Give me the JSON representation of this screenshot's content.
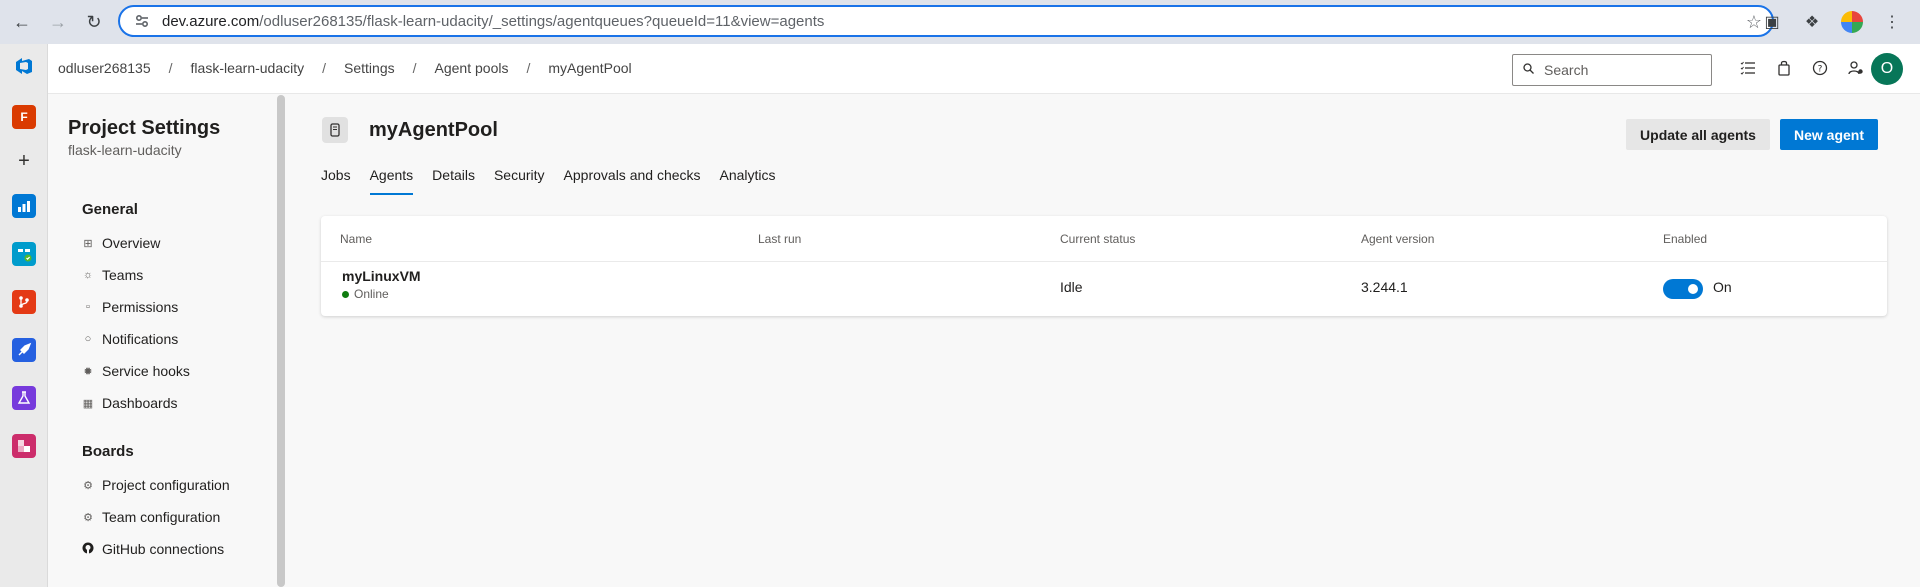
{
  "browser": {
    "url_host": "dev.azure.com",
    "url_path": "/odluser268135/flask-learn-udacity/_settings/agentqueues?queueId=11&view=agents"
  },
  "breadcrumb": {
    "items": [
      "odluser268135",
      "flask-learn-udacity",
      "Settings",
      "Agent pools",
      "myAgentPool"
    ],
    "separator": "/"
  },
  "search": {
    "placeholder": "Search"
  },
  "user": {
    "avatar_initial": "O"
  },
  "rail": {
    "project_initial": "F"
  },
  "settings_nav": {
    "title": "Project Settings",
    "subtitle": "flask-learn-udacity",
    "groups": [
      {
        "label": "General",
        "items": [
          "Overview",
          "Teams",
          "Permissions",
          "Notifications",
          "Service hooks",
          "Dashboards"
        ]
      },
      {
        "label": "Boards",
        "items": [
          "Project configuration",
          "Team configuration",
          "GitHub connections"
        ]
      }
    ]
  },
  "pool": {
    "title": "myAgentPool",
    "update_button": "Update all agents",
    "new_button": "New agent"
  },
  "tabs": [
    {
      "label": "Jobs",
      "active": false
    },
    {
      "label": "Agents",
      "active": true
    },
    {
      "label": "Details",
      "active": false
    },
    {
      "label": "Security",
      "active": false
    },
    {
      "label": "Approvals and checks",
      "active": false
    },
    {
      "label": "Analytics",
      "active": false
    }
  ],
  "table": {
    "columns": [
      "Name",
      "Last run",
      "Current status",
      "Agent version",
      "Enabled"
    ],
    "rows": [
      {
        "name": "myLinuxVM",
        "online_status": "Online",
        "last_run": "",
        "current_status": "Idle",
        "agent_version": "3.244.1",
        "enabled_label": "On",
        "enabled": true
      }
    ]
  },
  "colors": {
    "accent": "#0078d4",
    "online": "#107c10",
    "avatar": "#077658"
  }
}
